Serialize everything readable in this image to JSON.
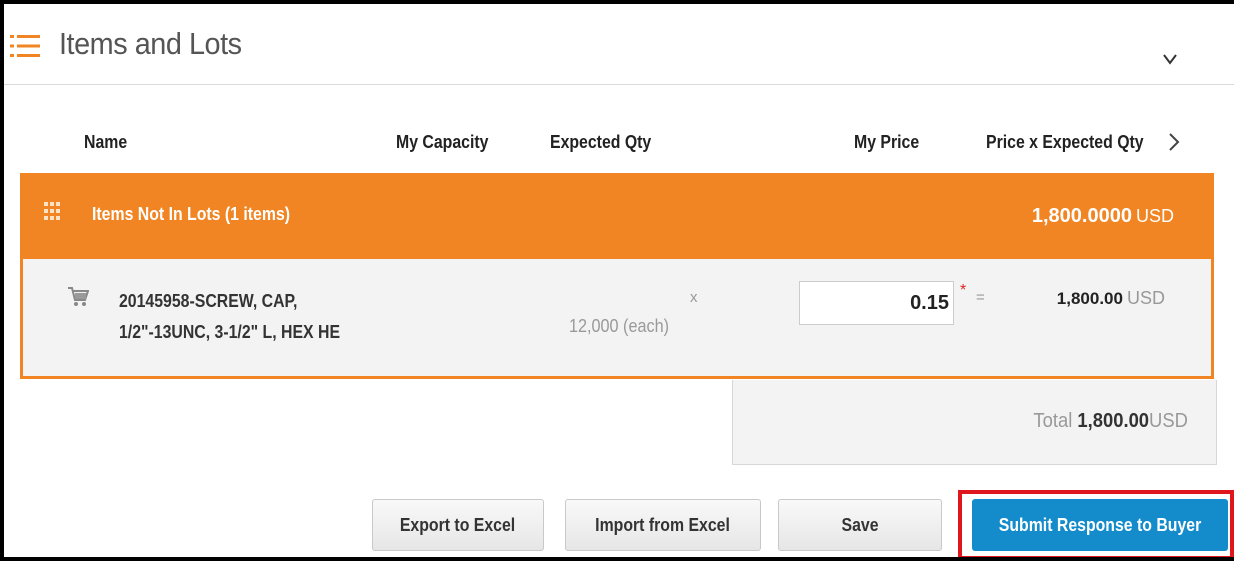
{
  "section": {
    "title": "Items and Lots"
  },
  "columns": {
    "name": "Name",
    "capacity": "My Capacity",
    "expected_qty": "Expected Qty",
    "my_price": "My Price",
    "price_x_qty": "Price x Expected Qty"
  },
  "group": {
    "label": "Items Not In Lots (1 items)",
    "total": "1,800.0000",
    "currency": "USD"
  },
  "item": {
    "name_line1": "20145958-SCREW, CAP,",
    "name_line2": "1/2\"-13UNC, 3-1/2\" L, HEX HE",
    "quantity": "12,000 (each)",
    "multiply": "x",
    "price_value": "0.15",
    "required_mark": "*",
    "equals": "=",
    "line_total": "1,800.00",
    "currency": "USD"
  },
  "total": {
    "label": "Total",
    "amount": "1,800.00",
    "currency": "USD"
  },
  "buttons": {
    "export": "Export to Excel",
    "import": "Import from Excel",
    "save": "Save",
    "submit": "Submit Response to Buyer"
  },
  "colors": {
    "accent": "#f18523",
    "primary": "#148ccb",
    "highlight": "#e0161e"
  },
  "icons": [
    "list-icon",
    "chevron-down-icon",
    "chevron-right-icon",
    "grid-icon",
    "cart-icon"
  ]
}
